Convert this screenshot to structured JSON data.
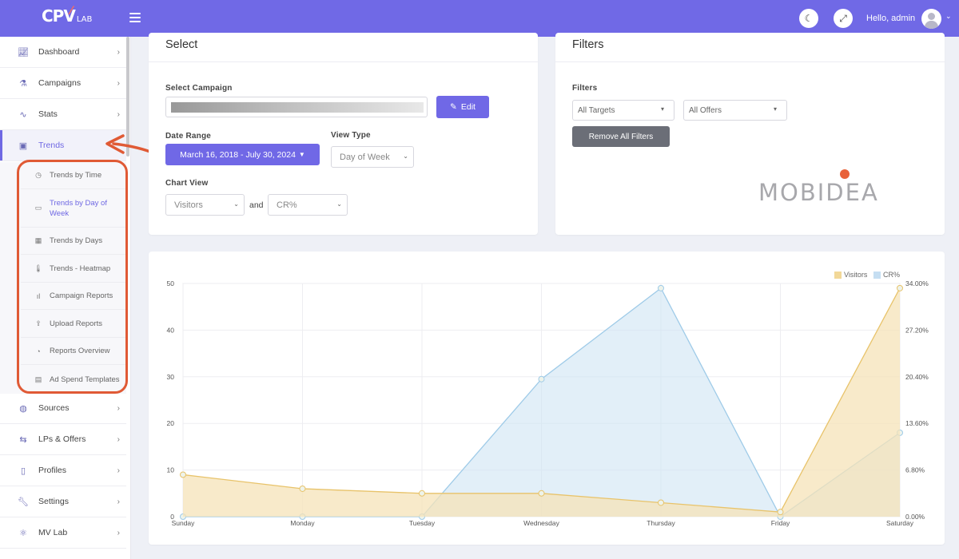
{
  "brand": {
    "logo_text": "CPV",
    "logo_sub": "LAB"
  },
  "header": {
    "greeting": "Hello, admin"
  },
  "sidebar": {
    "items": [
      {
        "label": "Dashboard",
        "icon": "chart-line-icon"
      },
      {
        "label": "Campaigns",
        "icon": "flask-icon"
      },
      {
        "label": "Stats",
        "icon": "stats-icon"
      },
      {
        "label": "Trends",
        "icon": "briefcase-icon",
        "active": true
      },
      {
        "label": "Sources",
        "icon": "globe-icon"
      },
      {
        "label": "LPs & Offers",
        "icon": "link-icon"
      },
      {
        "label": "Profiles",
        "icon": "clipboard-icon"
      },
      {
        "label": "Settings",
        "icon": "wrench-icon"
      },
      {
        "label": "MV Lab",
        "icon": "atom-icon"
      }
    ],
    "trends_submenu": [
      {
        "label": "Trends by Time",
        "icon": "clock-icon"
      },
      {
        "label": "Trends by Day of Week",
        "icon": "calendar-icon",
        "active": true
      },
      {
        "label": "Trends by Days",
        "icon": "calendar-grid-icon"
      },
      {
        "label": "Trends - Heatmap",
        "icon": "thermometer-icon"
      },
      {
        "label": "Campaign Reports",
        "icon": "bar-chart-icon"
      },
      {
        "label": "Upload Reports",
        "icon": "upload-icon"
      },
      {
        "label": "Reports Overview",
        "icon": "pie-chart-icon"
      },
      {
        "label": "Ad Spend Templates",
        "icon": "document-icon"
      }
    ]
  },
  "select_card": {
    "title": "Select",
    "campaign_label": "Select Campaign",
    "edit_button": "Edit",
    "date_range_label": "Date Range",
    "date_range_value": "March 16, 2018 - July 30, 2024",
    "view_type_label": "View Type",
    "view_type_value": "Day of Week",
    "chart_view_label": "Chart View",
    "chart_view_primary": "Visitors",
    "chart_view_and": "and",
    "chart_view_secondary": "CR%"
  },
  "filters_card": {
    "title": "Filters",
    "filters_label": "Filters",
    "targets_value": "All Targets",
    "offers_value": "All Offers",
    "remove_button": "Remove All Filters",
    "partner_logo": "MOBIDEA"
  },
  "colors": {
    "accent": "#7068e6",
    "visitors_fill": "#f5e3b8",
    "visitors_line": "#e8c36a",
    "cr_fill": "#cfe4f4",
    "cr_line": "#9fcbe8",
    "highlight": "#e05a35"
  },
  "chart_data": {
    "type": "area",
    "categories": [
      "Sunday",
      "Monday",
      "Tuesday",
      "Wednesday",
      "Thursday",
      "Friday",
      "Saturday"
    ],
    "series": [
      {
        "name": "Visitors",
        "axis": "left",
        "values": [
          9,
          6,
          5,
          5,
          3,
          1,
          49
        ]
      },
      {
        "name": "CR%",
        "axis": "right",
        "values": [
          0,
          0,
          0,
          29.5,
          49,
          0,
          18
        ]
      }
    ],
    "y_left_ticks": [
      "0",
      "10",
      "20",
      "30",
      "40",
      "50"
    ],
    "y_right_ticks": [
      "0.00%",
      "6.80%",
      "13.60%",
      "20.40%",
      "27.20%",
      "34.00%"
    ],
    "ylim": [
      0,
      50
    ],
    "legend_position": "top-right",
    "grid": true
  }
}
